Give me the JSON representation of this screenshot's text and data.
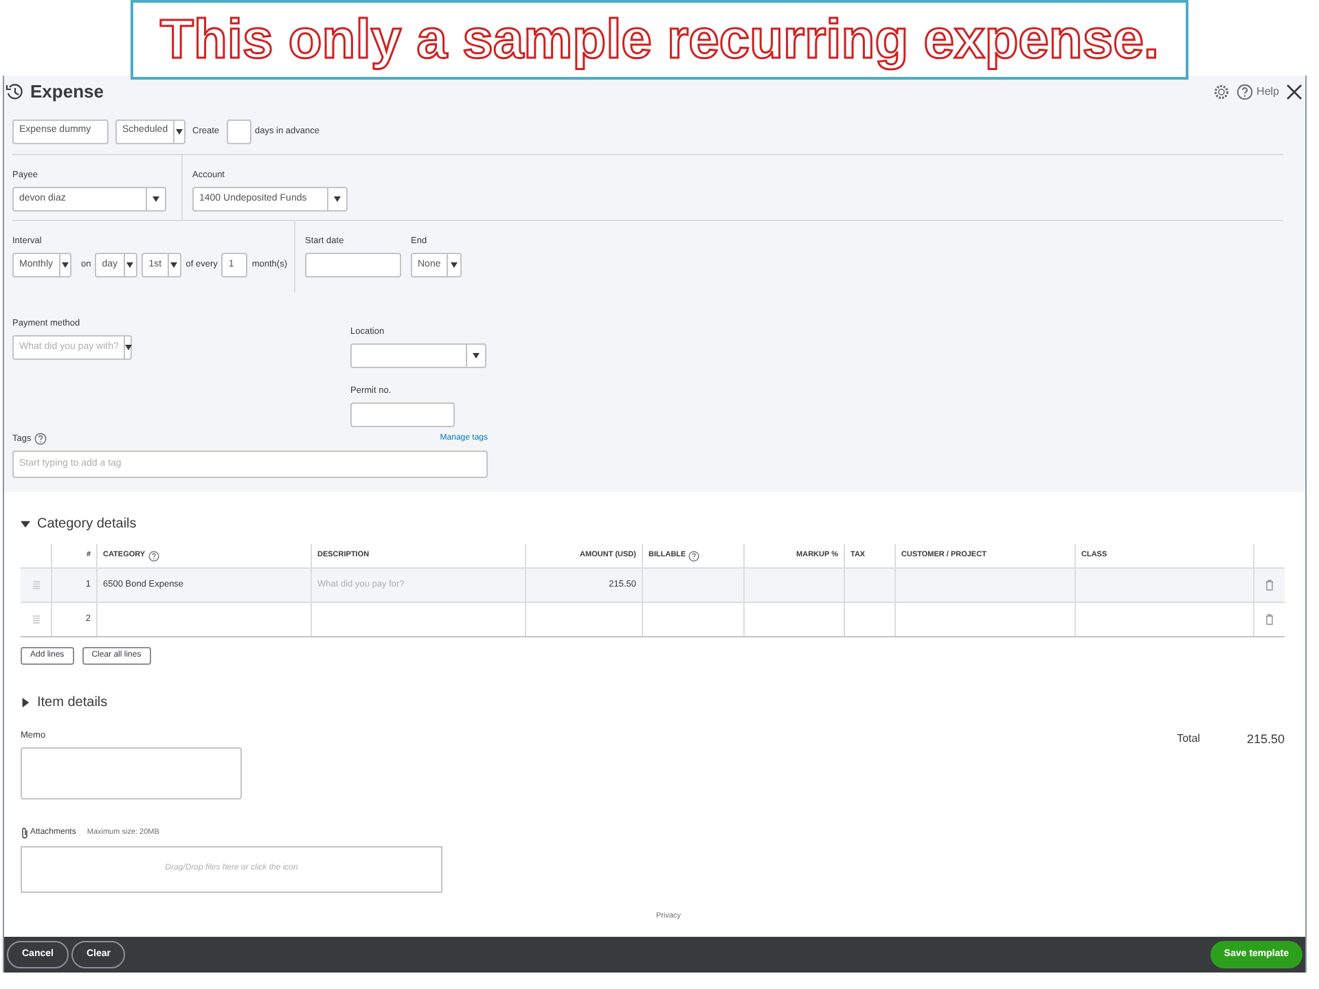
{
  "banner": {
    "text": "This only a sample recurring expense."
  },
  "header": {
    "title": "Expense",
    "help": "Help"
  },
  "template": {
    "name": "Expense dummy",
    "type": "Scheduled",
    "create_label": "Create",
    "days_suffix": "days in advance"
  },
  "payee": {
    "label": "Payee",
    "value": "devon diaz"
  },
  "account": {
    "label": "Account",
    "value": "1400 Undeposited Funds"
  },
  "interval": {
    "label": "Interval",
    "frequency": "Monthly",
    "on_label": "on",
    "day_type": "day",
    "day": "1st",
    "of_every_label": "of every",
    "every": "1",
    "unit_label": "month(s)"
  },
  "start_date": {
    "label": "Start date"
  },
  "end": {
    "label": "End",
    "value": "None"
  },
  "payment_method": {
    "label": "Payment method",
    "placeholder": "What did you pay with?"
  },
  "location": {
    "label": "Location"
  },
  "permit": {
    "label": "Permit no."
  },
  "tags": {
    "label": "Tags",
    "manage_link": "Manage tags",
    "placeholder": "Start typing to add a tag"
  },
  "category_details": {
    "title": "Category details",
    "expanded": true
  },
  "table": {
    "columns": [
      {
        "label": "#",
        "help": false
      },
      {
        "label": "CATEGORY",
        "help": true
      },
      {
        "label": "DESCRIPTION",
        "help": false
      },
      {
        "label": "AMOUNT (USD)",
        "help": false
      },
      {
        "label": "BILLABLE",
        "help": true
      },
      {
        "label": "MARKUP %",
        "help": false
      },
      {
        "label": "TAX",
        "help": false
      },
      {
        "label": "CUSTOMER / PROJECT",
        "help": false
      },
      {
        "label": "CLASS",
        "help": false
      }
    ],
    "rows": [
      {
        "number": "1",
        "category": "6500 Bond Expense",
        "description_placeholder": "What did you pay for?",
        "amount": "215.50",
        "selected": true
      },
      {
        "number": "2",
        "selected": false
      }
    ]
  },
  "table_buttons": [
    "Add lines",
    "Clear all lines"
  ],
  "item_details": {
    "title": "Item details",
    "expanded": false
  },
  "memo": {
    "label": "Memo"
  },
  "total": {
    "label": "Total",
    "value": "215.50"
  },
  "attachments": {
    "label": "Attachments",
    "max_size": "Maximum size: 20MB",
    "drop_text": "Drag/Drop files here or click the icon"
  },
  "privacy": "Privacy",
  "footer": {
    "left_buttons": [
      "Cancel",
      "Clear"
    ],
    "save": "Save template"
  }
}
